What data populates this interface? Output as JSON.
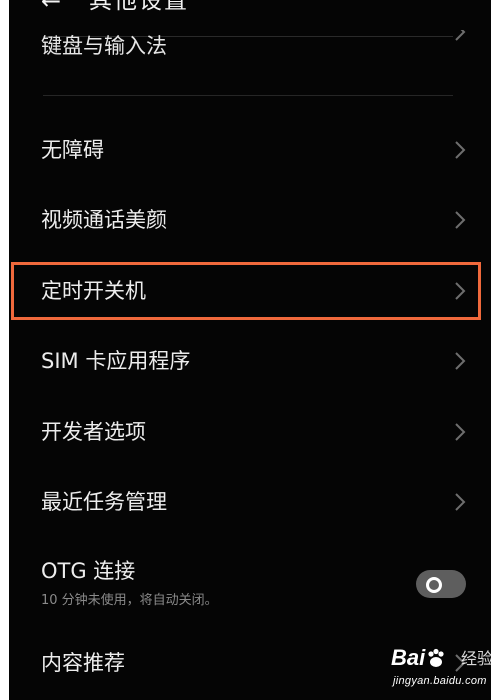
{
  "header": {
    "back_icon": "←",
    "title": "其他设置"
  },
  "cut_item": {
    "label": "键盘与输入法"
  },
  "items": [
    {
      "label": "无障碍"
    },
    {
      "label": "视频通话美颜"
    },
    {
      "label": "定时开关机"
    },
    {
      "label": "SIM 卡应用程序"
    },
    {
      "label": "开发者选项"
    },
    {
      "label": "最近任务管理"
    }
  ],
  "otg": {
    "label": "OTG 连接",
    "sub": "10 分钟未使用，将自动关闭。",
    "toggle_state": "off"
  },
  "last_item": {
    "label": "内容推荐"
  },
  "highlight_color": "#f0693c",
  "watermark": {
    "logo_left": "Bai",
    "logo_right": "经验",
    "url": "jingyan.baidu.com"
  }
}
